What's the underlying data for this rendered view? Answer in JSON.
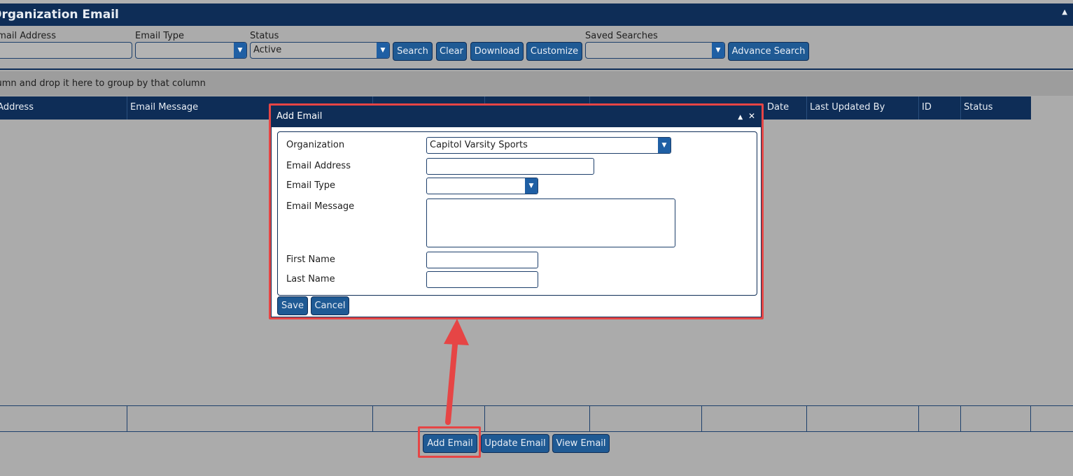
{
  "page": {
    "title": "Organization Email"
  },
  "filters": {
    "address_label": "Email Address",
    "email_type_label": "Email Type",
    "email_type_value": "",
    "status_label": "Status",
    "status_value": "Active",
    "saved_searches_label": "Saved Searches",
    "saved_searches_value": ""
  },
  "toolbar": {
    "search": "Search",
    "clear": "Clear",
    "download": "Download",
    "customize": "Customize",
    "advance_search": "Advance Search"
  },
  "grouping_hint": "Drag a column and drop it here to group by that column",
  "grid": {
    "columns": [
      "Email Address",
      "Email Message",
      "",
      "",
      "",
      "Date",
      "Last Updated By",
      "ID",
      "Status"
    ]
  },
  "bottom_buttons": {
    "add": "Add Email",
    "update": "Update Email",
    "view": "View Email"
  },
  "dialog": {
    "title": "Add Email",
    "fields": {
      "organization_label": "Organization",
      "organization_value": "Capitol Varsity Sports",
      "email_address_label": "Email Address",
      "email_address_value": "",
      "email_type_label": "Email Type",
      "email_type_value": "",
      "email_message_label": "Email Message",
      "email_message_value": "",
      "first_name_label": "First Name",
      "first_name_value": "",
      "last_name_label": "Last Name",
      "last_name_value": ""
    },
    "save": "Save",
    "cancel": "Cancel"
  },
  "colors": {
    "header_navy": "#0e2d57",
    "button_blue": "#1f5a94",
    "annotation_red": "#e64545",
    "overlay_gray": "#ababab"
  },
  "icons": [
    "collapse-up-icon",
    "dropdown-arrow-icon",
    "close-icon",
    "minimize-icon"
  ]
}
